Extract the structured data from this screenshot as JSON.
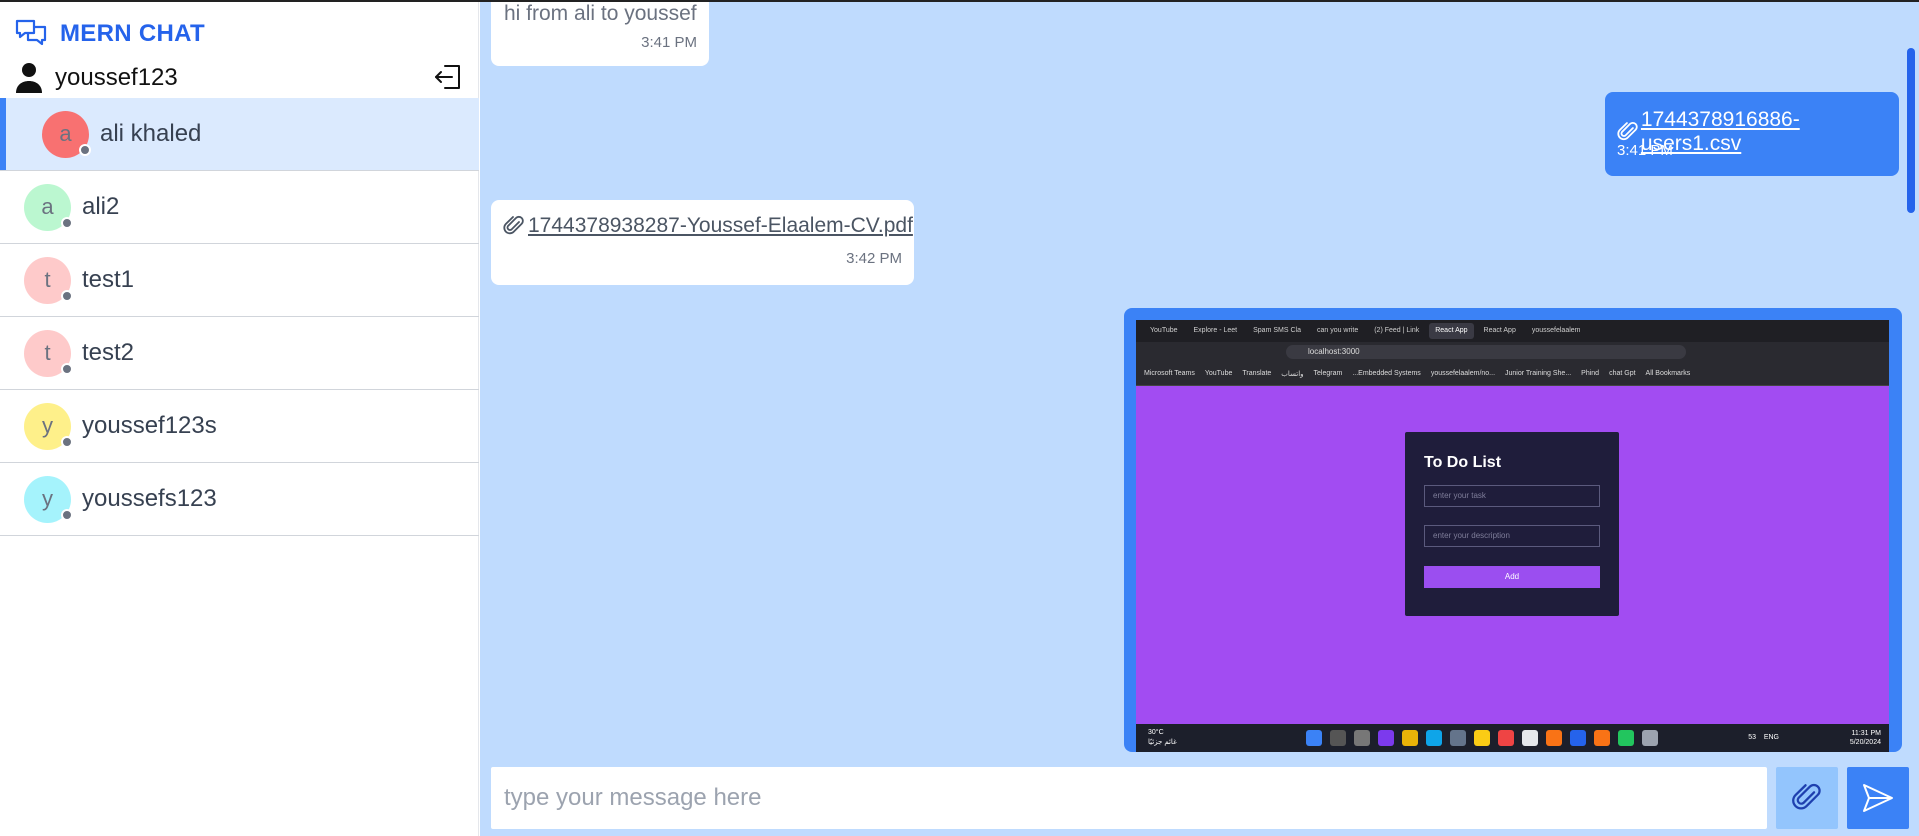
{
  "app": {
    "name": "MERN CHAT",
    "icon": "chat-bubbles-icon"
  },
  "current_user": {
    "username": "youssef123",
    "logout_icon": "logout-icon"
  },
  "contacts": [
    {
      "initial": "a",
      "name": "ali khaled",
      "avatar_color": "#f87171",
      "active": true
    },
    {
      "initial": "a",
      "name": "ali2",
      "avatar_color": "#bbf7d0",
      "active": false
    },
    {
      "initial": "t",
      "name": "test1",
      "avatar_color": "#fecaca",
      "active": false
    },
    {
      "initial": "t",
      "name": "test2",
      "avatar_color": "#fecaca",
      "active": false
    },
    {
      "initial": "y",
      "name": "youssef123s",
      "avatar_color": "#fef08a",
      "active": false
    },
    {
      "initial": "y",
      "name": "youssefs123",
      "avatar_color": "#a5f3fc",
      "active": false
    }
  ],
  "messages": [
    {
      "type": "text",
      "from": "other",
      "text": "hi from ali to youssef",
      "time": "3:41 PM"
    },
    {
      "type": "file",
      "from": "me",
      "filename": "1744378916886-users1.csv",
      "time": "3:41 PM"
    },
    {
      "type": "file",
      "from": "other",
      "filename": "1744378938287-Youssef-Elaalem-CV.pdf",
      "time": "3:42 PM"
    },
    {
      "type": "image",
      "from": "me"
    }
  ],
  "image_content": {
    "tabs": [
      "YouTube",
      "Explore - Leet",
      "Spam SMS Cla",
      "can you write",
      "(2) Feed | Link",
      "React App",
      "React App",
      "youssefelaalem"
    ],
    "url": "localhost:3000",
    "bookmarks": [
      "Microsoft Teams",
      "YouTube",
      "Translate",
      "واتساب",
      "Telegram",
      "...Embedded Systems",
      "youssefelaalem/no...",
      "Junior Training She...",
      "Phind",
      "chat Gpt",
      "All Bookmarks"
    ],
    "todo_title": "To Do List",
    "task_placeholder": "enter your task",
    "description_placeholder": "enter your description",
    "add_label": "Add",
    "weather_temp": "30°C",
    "weather_text": "غائم جزئيًا",
    "tray_count": "53",
    "tray_lang": "ENG",
    "clock_time": "11:31 PM",
    "clock_date": "5/20/2024"
  },
  "composer": {
    "placeholder": "type your message here"
  },
  "colors": {
    "accent": "#2563eb",
    "chat_bg": "#bfdbfe",
    "my_bubble": "#3b82f6"
  }
}
